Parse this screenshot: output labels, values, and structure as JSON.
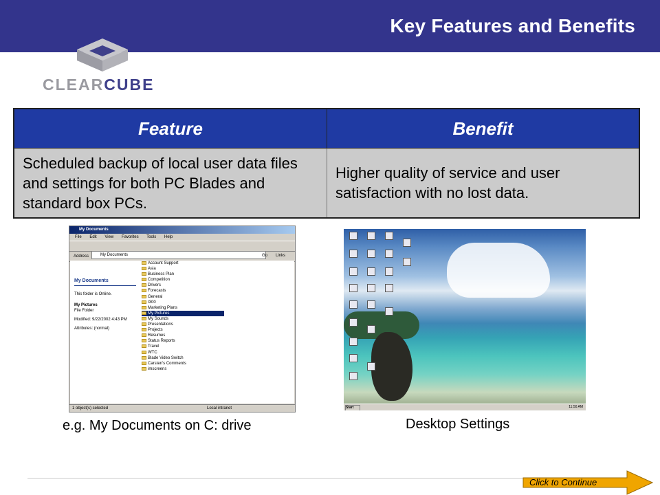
{
  "header": {
    "title": "Key Features and Benefits",
    "bar_color": "#33348c"
  },
  "logo": {
    "part1": "CLEAR",
    "part2": "CUBE"
  },
  "table": {
    "headers": [
      "Feature",
      "Benefit"
    ],
    "rows": [
      [
        "Scheduled backup of local user data files and settings for both PC Blades and standard box PCs.",
        "Higher quality of service and user satisfaction with no lost data."
      ]
    ],
    "header_color": "#1f3aa3",
    "cell_color": "#cbcbcb"
  },
  "screenshot1": {
    "window_title": "My Documents",
    "menu": [
      "File",
      "Edit",
      "View",
      "Favorites",
      "Tools",
      "Help"
    ],
    "address_label": "Address",
    "address_value": "My Documents",
    "go": "Go",
    "links": "Links",
    "folder_heading": "My Documents",
    "online_note": "This folder is Online.",
    "selected_name": "My Pictures",
    "selected_type": "File Folder",
    "modified": "Modified: 9/22/2002 4:43 PM",
    "attributes": "Attributes: (normal)",
    "folders": [
      "Account Support",
      "Asia",
      "Business Plan",
      "Competition",
      "Drivers",
      "Forecasts",
      "General",
      "I300",
      "Marketing Plans",
      "My Pictures",
      "My Sounds",
      "Presentations",
      "Projects",
      "Resumes",
      "Status Reports",
      "Travel",
      "WTC",
      "Blade Video Switch",
      "Carsten's Comments",
      "imscreens"
    ],
    "status_left": "1 object(s) selected",
    "status_right": "Local intranet"
  },
  "screenshot2": {
    "start": "Start",
    "clock": "11:50 AM"
  },
  "captions": {
    "left": "e.g. My Documents on C: drive",
    "right": "Desktop Settings"
  },
  "continue_button": "Click to Continue"
}
